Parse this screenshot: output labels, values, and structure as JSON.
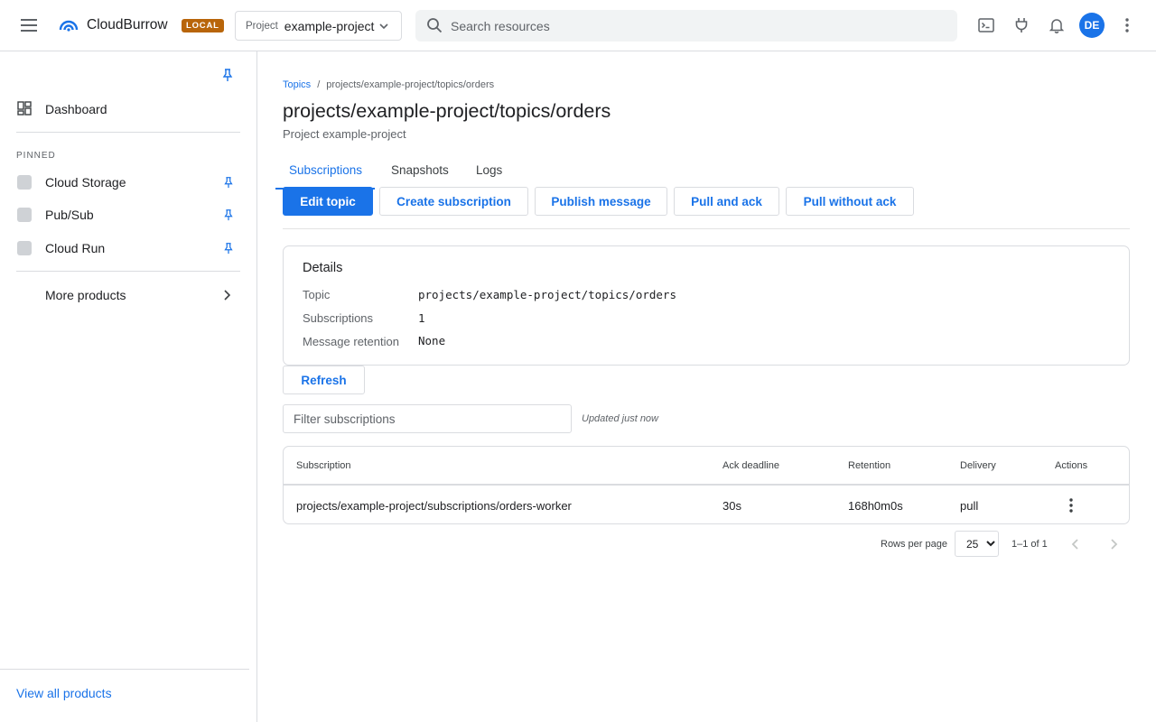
{
  "header": {
    "menu_icon": "hamburger-menu-icon",
    "logo_icon": "cloud-arc-logo-icon",
    "brand": "CloudBurrow",
    "badge": "LOCAL",
    "project_label": "Project",
    "project_value": "example-project",
    "search_placeholder": "Search resources",
    "icons": [
      "terminal-icon",
      "plug-icon",
      "bell-icon",
      "more-vert-icon"
    ],
    "avatar_initials": "DE"
  },
  "sidebar": {
    "dashboard": "Dashboard",
    "pinned_heading": "PINNED",
    "pinned_items": [
      {
        "label": "Cloud Storage"
      },
      {
        "label": "Pub/Sub"
      },
      {
        "label": "Cloud Run"
      }
    ],
    "more_products": "More products",
    "view_all": "View all products"
  },
  "breadcrumb": {
    "parent": "Topics",
    "separator": "/",
    "current": "projects/example-project/topics/orders"
  },
  "page": {
    "title": "projects/example-project/topics/orders",
    "subtitle": "Project example-project"
  },
  "tabs": [
    {
      "label": "Subscriptions",
      "active": true
    },
    {
      "label": "Snapshots",
      "active": false
    },
    {
      "label": "Logs",
      "active": false
    }
  ],
  "actions": {
    "edit": "Edit topic",
    "create": "Create subscription",
    "publish": "Publish message",
    "pull_ack": "Pull and ack",
    "pull_no_ack": "Pull without ack"
  },
  "details": {
    "heading": "Details",
    "rows": [
      {
        "label": "Topic",
        "value": "projects/example-project/topics/orders"
      },
      {
        "label": "Subscriptions",
        "value": "1"
      },
      {
        "label": "Message retention",
        "value": "None"
      }
    ]
  },
  "controls": {
    "refresh": "Refresh",
    "filter_placeholder": "Filter subscriptions",
    "updated": "Updated just now"
  },
  "table": {
    "columns": [
      "Subscription",
      "Ack deadline",
      "Retention",
      "Delivery",
      "Actions"
    ],
    "rows": [
      {
        "subscription": "projects/example-project/subscriptions/orders-worker",
        "ack_deadline": "30s",
        "retention": "168h0m0s",
        "delivery": "pull"
      }
    ]
  },
  "pagination": {
    "rows_per_page_label": "Rows per page",
    "rows_per_page": "25",
    "range": "1–1 of 1"
  },
  "colors": {
    "accent": "#1a73e8",
    "badge": "#b8650a"
  }
}
